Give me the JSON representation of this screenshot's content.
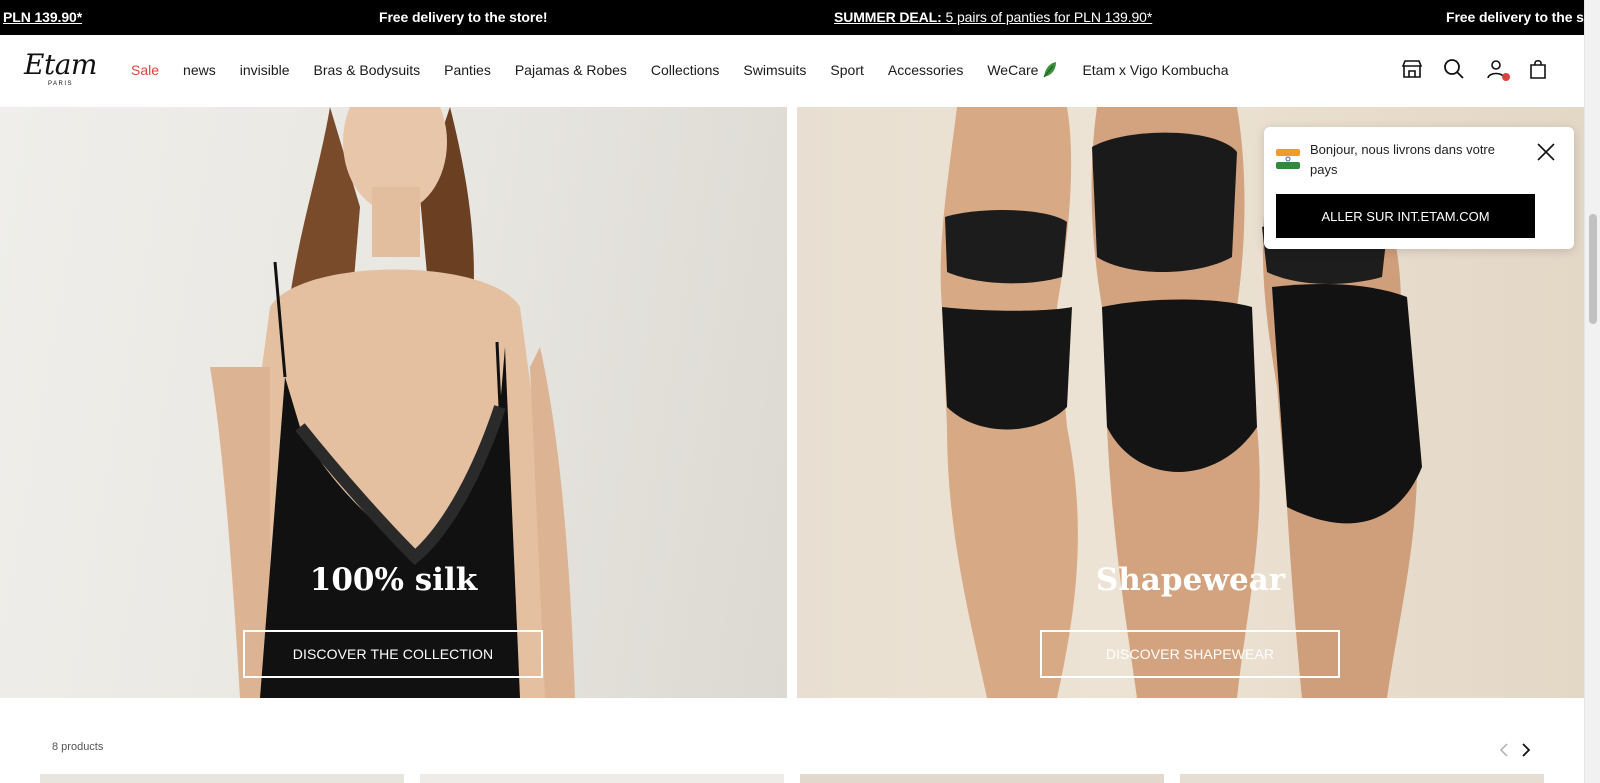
{
  "promo": {
    "item1": "PLN 139.90*",
    "item2": "Free delivery to the store!",
    "item3_bold": "SUMMER DEAL:",
    "item3_rest": " 5 pairs of panties for PLN 139.90*",
    "item4": "Free delivery to the st"
  },
  "header": {
    "logo": "Etam",
    "logo_sub": "PARIS",
    "nav": [
      "Sale",
      "news",
      "invisible",
      "Bras & Bodysuits",
      "Panties",
      "Pajamas & Robes",
      "Collections",
      "Swimsuits",
      "Sport",
      "Accessories",
      "WeCare",
      "Etam x Vigo Kombucha"
    ],
    "icons": [
      "store-icon",
      "search-icon",
      "account-icon",
      "cart-icon"
    ]
  },
  "hero": {
    "left": {
      "title": "100% silk",
      "button": "DISCOVER THE COLLECTION"
    },
    "right": {
      "title": "Shapewear",
      "button": "DISCOVER SHAPEWEAR"
    }
  },
  "popup": {
    "message": "Bonjour, nous livrons dans votre pays",
    "button": "ALLER SUR INT.ETAM.COM"
  },
  "products": {
    "count_label": "8 products"
  },
  "colors": {
    "accent": "#d9453c",
    "promo_bg": "#000000",
    "button_bg": "#000000"
  }
}
